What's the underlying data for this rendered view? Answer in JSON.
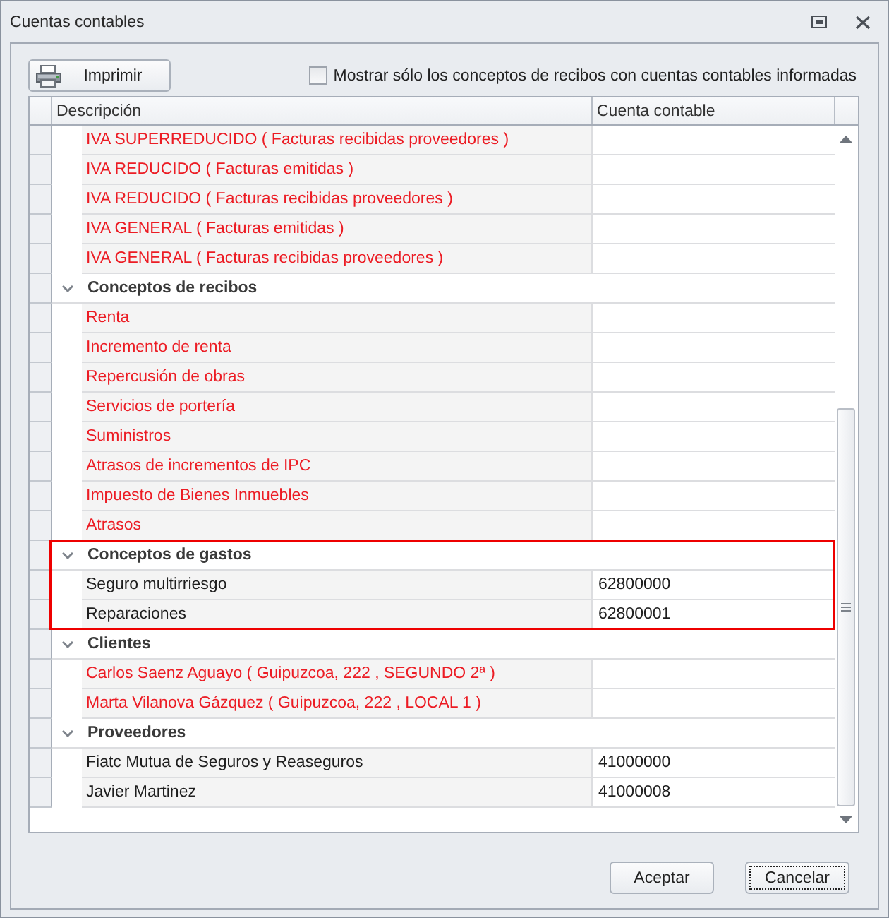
{
  "window": {
    "title": "Cuentas contables"
  },
  "toolbar": {
    "print_button": {
      "label": "Imprimir"
    },
    "filter": {
      "label": "Mostrar sólo los conceptos de recibos con cuentas contables informadas",
      "checked": false
    }
  },
  "grid": {
    "columns": [
      {
        "label": "Descripción"
      },
      {
        "label": "Cuenta contable"
      }
    ],
    "groups": [
      {
        "highlighted": false,
        "rows": [
          {
            "description": "IVA SUPERREDUCIDO ( Facturas recibidas proveedores )",
            "missing_account": true
          },
          {
            "description": "IVA REDUCIDO ( Facturas emitidas )",
            "missing_account": true
          },
          {
            "description": "IVA REDUCIDO ( Facturas recibidas proveedores )",
            "missing_account": true
          },
          {
            "description": "IVA GENERAL ( Facturas emitidas )",
            "missing_account": true
          },
          {
            "description": "IVA GENERAL ( Facturas recibidas proveedores )",
            "missing_account": true
          }
        ]
      },
      {
        "title": "Conceptos de recibos",
        "expanded": true,
        "highlighted": false,
        "rows": [
          {
            "description": "Renta",
            "missing_account": true
          },
          {
            "description": "Incremento de renta",
            "missing_account": true
          },
          {
            "description": "Repercusión de obras",
            "missing_account": true
          },
          {
            "description": "Servicios de portería",
            "missing_account": true
          },
          {
            "description": "Suministros",
            "missing_account": true
          },
          {
            "description": "Atrasos de incrementos de IPC",
            "missing_account": true
          },
          {
            "description": "Impuesto de Bienes Inmuebles",
            "missing_account": true
          },
          {
            "description": "Atrasos",
            "missing_account": true
          }
        ]
      },
      {
        "title": "Conceptos de gastos",
        "expanded": true,
        "highlighted": true,
        "rows": [
          {
            "description": "Seguro multirriesgo",
            "account": "62800000",
            "missing_account": false
          },
          {
            "description": "Reparaciones",
            "account": "62800001",
            "missing_account": false
          }
        ]
      },
      {
        "title": "Clientes",
        "expanded": true,
        "highlighted": false,
        "rows": [
          {
            "description": "Carlos Saenz Aguayo ( Guipuzcoa, 222 , SEGUNDO 2ª )",
            "missing_account": true
          },
          {
            "description": "Marta Vilanova Gázquez ( Guipuzcoa, 222 , LOCAL 1 )",
            "missing_account": true
          }
        ]
      },
      {
        "title": "Proveedores",
        "expanded": true,
        "highlighted": false,
        "rows": [
          {
            "description": "Fiatc Mutua de Seguros y Reaseguros",
            "account": "41000000",
            "missing_account": false
          },
          {
            "description": "Javier Martinez",
            "account": "41000008",
            "missing_account": false
          }
        ]
      }
    ]
  },
  "buttons": [
    {
      "label": "Aceptar",
      "focused": false
    },
    {
      "label": "Cancelar",
      "focused": true
    }
  ]
}
